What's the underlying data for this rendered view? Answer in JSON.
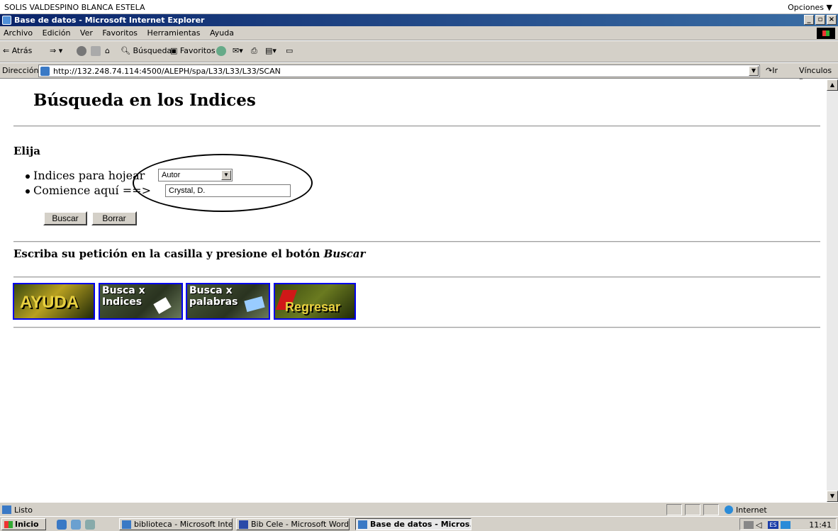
{
  "session": {
    "user": "SOLIS VALDESPINO BLANCA ESTELA",
    "options": "Opciones ▼"
  },
  "window": {
    "title": "Base de datos - Microsoft Internet Explorer"
  },
  "menu": [
    "Archivo",
    "Edición",
    "Ver",
    "Favoritos",
    "Herramientas",
    "Ayuda"
  ],
  "toolbar": {
    "back": "⇐ Atrás",
    "search": "Búsqueda",
    "favorites": "Favoritos"
  },
  "address": {
    "label": "Dirección",
    "url": "http://132.248.74.114:4500/ALEPH/spa/L33/L33/L33/SCAN",
    "go": "Ir",
    "links": "Vínculos »"
  },
  "page": {
    "title": "Búsqueda en los Indices",
    "elija": "Elija",
    "index_label": "Indices para hojear",
    "index_value": "Autor",
    "start_label": "Comience aquí",
    "start_arrow": "==>",
    "start_value": "Crystal, D.",
    "search_button": "Buscar",
    "clear_button": "Borrar",
    "instruction_prefix": "Escriba su petición en la casilla y presione el botón",
    "instruction_action": "Buscar"
  },
  "nav_buttons": [
    {
      "label": "AYUDA"
    },
    {
      "label_line1": "Busca x",
      "label_line2": "Indices"
    },
    {
      "label_line1": "Busca x",
      "label_line2": "palabras"
    },
    {
      "label": "Regresar"
    }
  ],
  "status": {
    "text": "Listo",
    "zone": "Internet"
  },
  "taskbar": {
    "start": "Inicio",
    "tasks": [
      "biblioteca - Microsoft Inte...",
      "Bib Cele - Microsoft Word",
      "Base de datos - Micros..."
    ],
    "lang": "ES",
    "clock": "11:41"
  }
}
